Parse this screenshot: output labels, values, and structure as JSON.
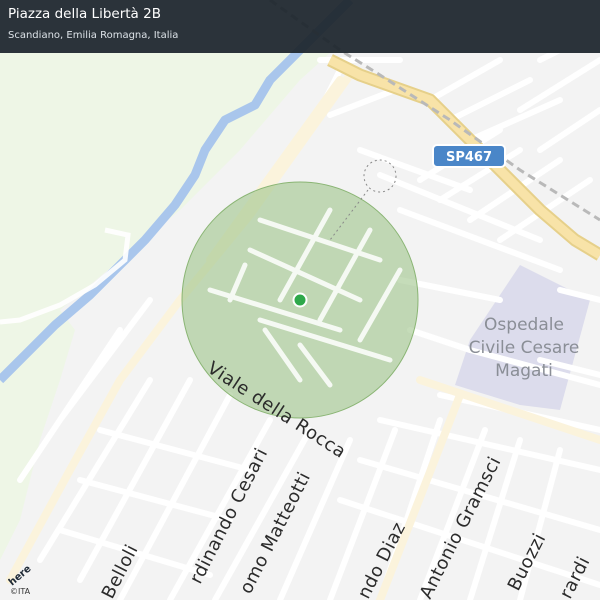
{
  "header": {
    "title": "Piazza della Libertà 2B",
    "subtitle": "Scandiano, Emilia Romagna, Italia"
  },
  "map": {
    "road_shield": "SP467",
    "poi": [
      "Ospedale",
      "Civile Cesare",
      "Magati"
    ],
    "streets": {
      "viale_della_rocca": "Viale della Rocca",
      "belloli": "Belloli",
      "ferdinando_cesari": "rdinando Cesari",
      "giacomo_matteotti": "omo Matteotti",
      "armando_diaz": "ndo Diaz",
      "antonio_gramsci": "Antonio Gramsci",
      "buozzi": "Buozzi",
      "gerardi": "rardi"
    },
    "colors": {
      "background": "#f3f3f3",
      "river": "#a9c6ec",
      "river_bank": "#eef6e6",
      "hospital": "#dcdcec",
      "major_road": "#f8e3a8",
      "radius_circle": "#9fc58a",
      "location_dot": "#2ea84a",
      "shield": "#4a86c8"
    }
  },
  "branding": {
    "logo": "here",
    "copyright": "©ITA"
  }
}
